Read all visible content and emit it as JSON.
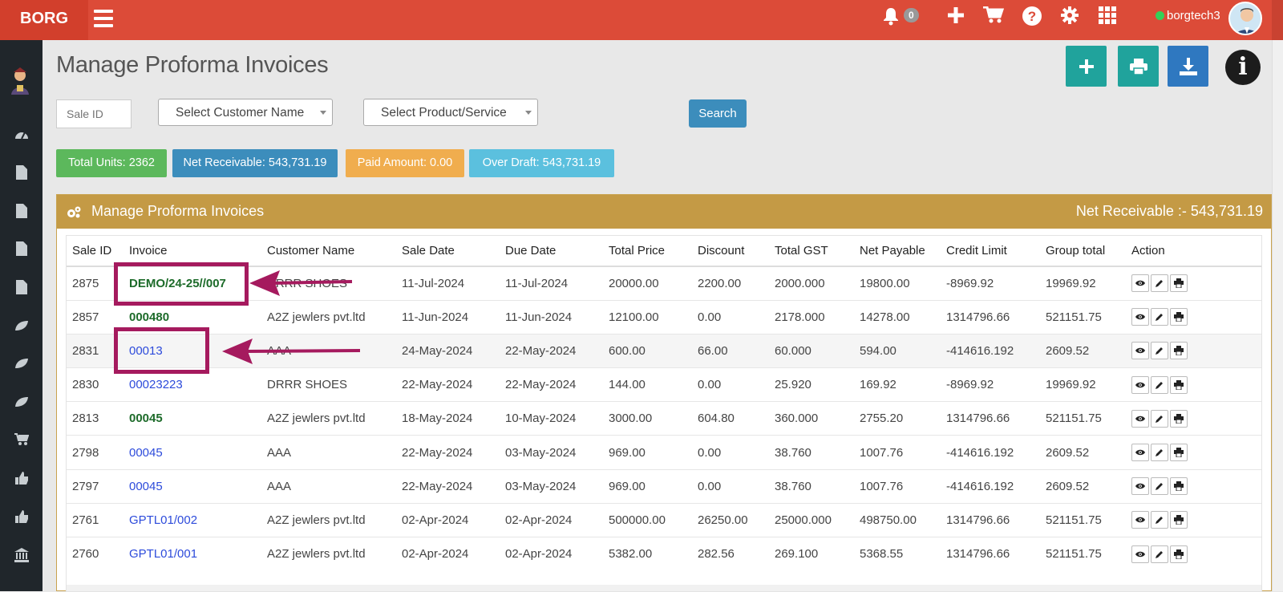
{
  "topbar": {
    "brand": "BORG",
    "notification_count": "0",
    "username": "borgtech3"
  },
  "page": {
    "title": "Manage Proforma Invoices"
  },
  "filters": {
    "sale_id_placeholder": "Sale ID",
    "customer_select": "Select Customer Name",
    "product_select": "Select Product/Service",
    "search_label": "Search"
  },
  "stats": {
    "total_units": "Total Units: 2362",
    "net_receivable": "Net Receivable: 543,731.19",
    "paid_amount": "Paid Amount: 0.00",
    "over_draft": "Over Draft: 543,731.19"
  },
  "panel": {
    "title": "Manage Proforma Invoices",
    "net_receivable": "Net Receivable :- 543,731.19"
  },
  "table": {
    "headers": [
      "Sale ID",
      "Invoice",
      "Customer Name",
      "Sale Date",
      "Due Date",
      "Total Price",
      "Discount",
      "Total GST",
      "Net Payable",
      "Credit Limit",
      "Group total",
      "Action"
    ],
    "rows": [
      {
        "sale_id": "2875",
        "invoice": "DEMO/24-25//007",
        "customer": "DRRR SHOES",
        "sale_date": "11-Jul-2024",
        "due_date": "11-Jul-2024",
        "total_price": "20000.00",
        "discount": "2200.00",
        "total_gst": "2000.000",
        "net_payable": "19800.00",
        "credit_limit": "-8969.92",
        "group_total": "19969.92"
      },
      {
        "sale_id": "2857",
        "invoice": "000480",
        "customer": "A2Z jewlers pvt.ltd",
        "sale_date": "11-Jun-2024",
        "due_date": "11-Jun-2024",
        "total_price": "12100.00",
        "discount": "0.00",
        "total_gst": "2178.000",
        "net_payable": "14278.00",
        "credit_limit": "1314796.66",
        "group_total": "521151.75"
      },
      {
        "sale_id": "2831",
        "invoice": "00013",
        "customer": "AAA",
        "sale_date": "24-May-2024",
        "due_date": "22-May-2024",
        "total_price": "600.00",
        "discount": "66.00",
        "total_gst": "60.000",
        "net_payable": "594.00",
        "credit_limit": "-414616.192",
        "group_total": "2609.52"
      },
      {
        "sale_id": "2830",
        "invoice": "00023223",
        "customer": "DRRR SHOES",
        "sale_date": "22-May-2024",
        "due_date": "22-May-2024",
        "total_price": "144.00",
        "discount": "0.00",
        "total_gst": "25.920",
        "net_payable": "169.92",
        "credit_limit": "-8969.92",
        "group_total": "19969.92"
      },
      {
        "sale_id": "2813",
        "invoice": "00045",
        "customer": "A2Z jewlers pvt.ltd",
        "sale_date": "18-May-2024",
        "due_date": "10-May-2024",
        "total_price": "3000.00",
        "discount": "604.80",
        "total_gst": "360.000",
        "net_payable": "2755.20",
        "credit_limit": "1314796.66",
        "group_total": "521151.75"
      },
      {
        "sale_id": "2798",
        "invoice": "00045",
        "customer": "AAA",
        "sale_date": "22-May-2024",
        "due_date": "03-May-2024",
        "total_price": "969.00",
        "discount": "0.00",
        "total_gst": "38.760",
        "net_payable": "1007.76",
        "credit_limit": "-414616.192",
        "group_total": "2609.52"
      },
      {
        "sale_id": "2797",
        "invoice": "00045",
        "customer": "AAA",
        "sale_date": "22-May-2024",
        "due_date": "03-May-2024",
        "total_price": "969.00",
        "discount": "0.00",
        "total_gst": "38.760",
        "net_payable": "1007.76",
        "credit_limit": "-414616.192",
        "group_total": "2609.52"
      },
      {
        "sale_id": "2761",
        "invoice": "GPTL01/002",
        "customer": "A2Z jewlers pvt.ltd",
        "sale_date": "02-Apr-2024",
        "due_date": "02-Apr-2024",
        "total_price": "500000.00",
        "discount": "26250.00",
        "total_gst": "25000.000",
        "net_payable": "498750.00",
        "credit_limit": "1314796.66",
        "group_total": "521151.75"
      },
      {
        "sale_id": "2760",
        "invoice": "GPTL01/001",
        "customer": "A2Z jewlers pvt.ltd",
        "sale_date": "02-Apr-2024",
        "due_date": "02-Apr-2024",
        "total_price": "5382.00",
        "discount": "282.56",
        "total_gst": "269.100",
        "net_payable": "5368.55",
        "credit_limit": "1314796.66",
        "group_total": "521151.75"
      }
    ]
  },
  "colors": {
    "topbar": "#dc4b38",
    "sidebar": "#20262b",
    "panel_header": "#c49a45",
    "teal_button": "#20a39c",
    "blue_button": "#2f78c0",
    "stat_green": "#5cb85c",
    "stat_blue": "#3c8dbc",
    "stat_orange": "#f0ad4e",
    "stat_cyan": "#5bc0de",
    "annotation": "#a51a5e",
    "invoice_green": "#1d6b2a",
    "invoice_blue": "#2d4bdb"
  }
}
